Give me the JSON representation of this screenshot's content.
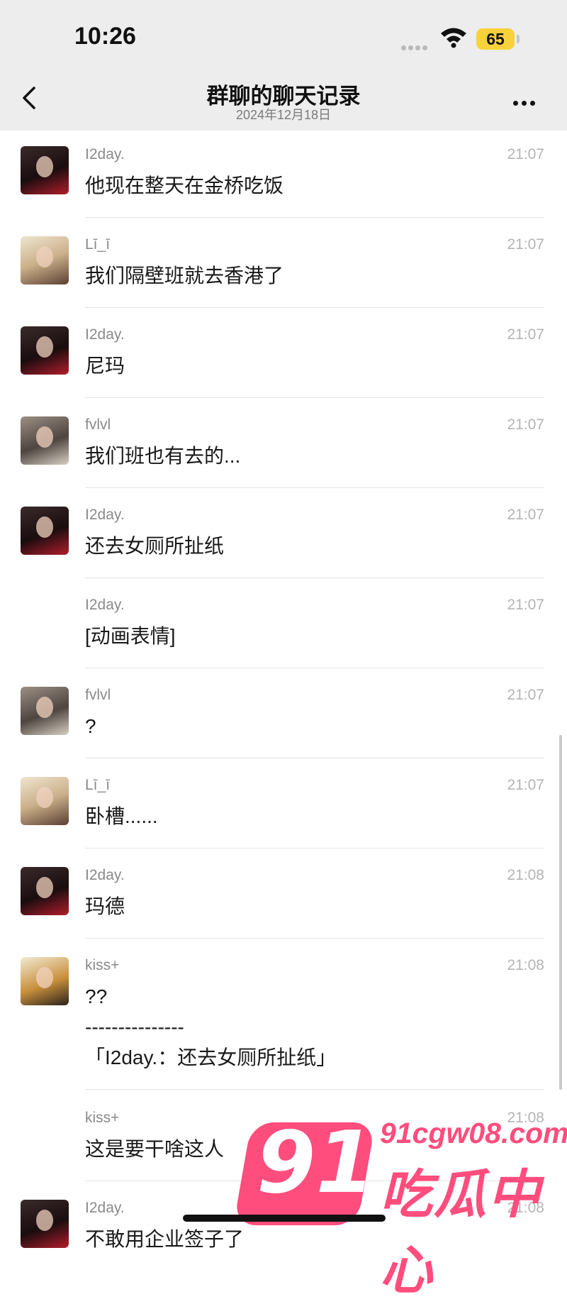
{
  "status_bar": {
    "time": "10:26",
    "battery": "65"
  },
  "nav": {
    "title": "群聊的聊天记录",
    "subtitle": "2024年12月18日"
  },
  "messages": [
    {
      "sender": "I2day.",
      "time": "21:07",
      "text": "他现在整天在金桥吃饭"
    },
    {
      "sender": "Lī_ī",
      "time": "21:07",
      "text": "我们隔壁班就去香港了"
    },
    {
      "sender": "I2day.",
      "time": "21:07",
      "text": "尼玛"
    },
    {
      "sender": "fvlvl",
      "time": "21:07",
      "text": "我们班也有去的..."
    },
    {
      "sender": "I2day.",
      "time": "21:07",
      "text": "还去女厕所扯纸"
    },
    {
      "sender": "I2day.",
      "time": "21:07",
      "text": "[动画表情]"
    },
    {
      "sender": "fvlvl",
      "time": "21:07",
      "text": "?"
    },
    {
      "sender": "Lī_ī",
      "time": "21:07",
      "text": "卧槽......"
    },
    {
      "sender": "I2day.",
      "time": "21:08",
      "text": "玛德"
    },
    {
      "sender": "kiss+",
      "time": "21:08",
      "text": "??",
      "separator": "---------------",
      "quote": "「I2day.：还去女厕所扯纸」"
    },
    {
      "sender": "kiss+",
      "time": "21:08",
      "text": "这是要干啥这人"
    },
    {
      "sender": "I2day.",
      "time": "21:08",
      "text": "不敢用企业签子了"
    }
  ],
  "watermark": {
    "number": "91",
    "site": "91cgw08.com",
    "name": "吃瓜中心"
  }
}
